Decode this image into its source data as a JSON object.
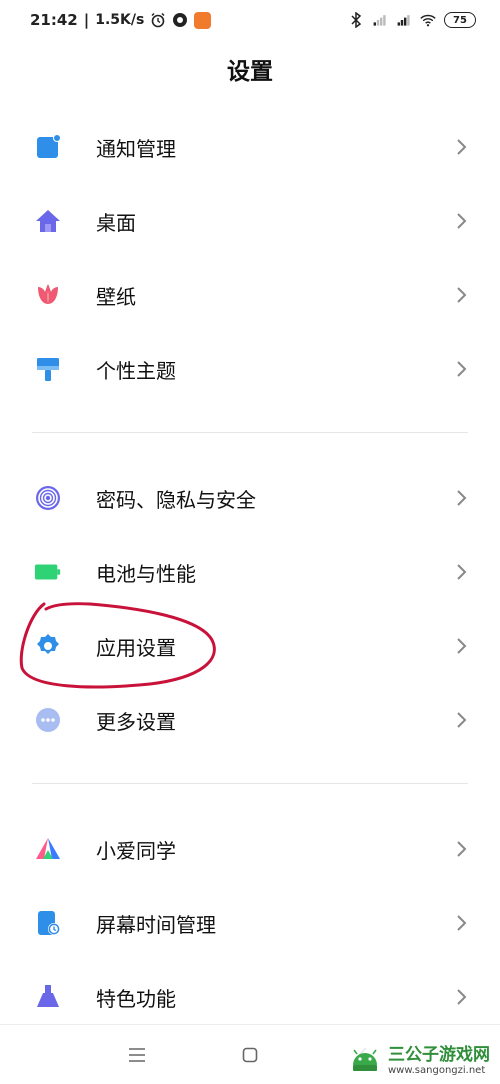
{
  "status_bar": {
    "time": "21:42",
    "separator": "|",
    "speed": "1.5K/s",
    "battery": "75"
  },
  "page": {
    "title": "设置"
  },
  "groups": [
    {
      "items": [
        {
          "label": "通知管理",
          "icon": "notification-icon",
          "color": "#2f8fe8"
        },
        {
          "label": "桌面",
          "icon": "home-icon",
          "color": "#6a67e8"
        },
        {
          "label": "壁纸",
          "icon": "tulip-icon",
          "color": "#ef5a72"
        },
        {
          "label": "个性主题",
          "icon": "paintbrush-icon",
          "color": "#2f8fe8"
        }
      ]
    },
    {
      "items": [
        {
          "label": "密码、隐私与安全",
          "icon": "fingerprint-icon",
          "color": "#6a67e8"
        },
        {
          "label": "电池与性能",
          "icon": "battery-icon",
          "color": "#2fd274"
        },
        {
          "label": "应用设置",
          "icon": "gear-icon",
          "color": "#2f8fe8"
        },
        {
          "label": "更多设置",
          "icon": "more-icon",
          "color": "#8aa4f0"
        }
      ]
    },
    {
      "items": [
        {
          "label": "小爱同学",
          "icon": "xiaoai-icon",
          "color": "#ff5a8a"
        },
        {
          "label": "屏幕时间管理",
          "icon": "screen-time-icon",
          "color": "#2f8fe8"
        },
        {
          "label": "特色功能",
          "icon": "flask-icon",
          "color": "#6a67e8"
        }
      ]
    }
  ],
  "colors": {
    "annotation": "#c8123a",
    "chevron": "#888888"
  },
  "watermark": {
    "title": "三公子游戏网",
    "url": "www.sangongzi.net"
  }
}
